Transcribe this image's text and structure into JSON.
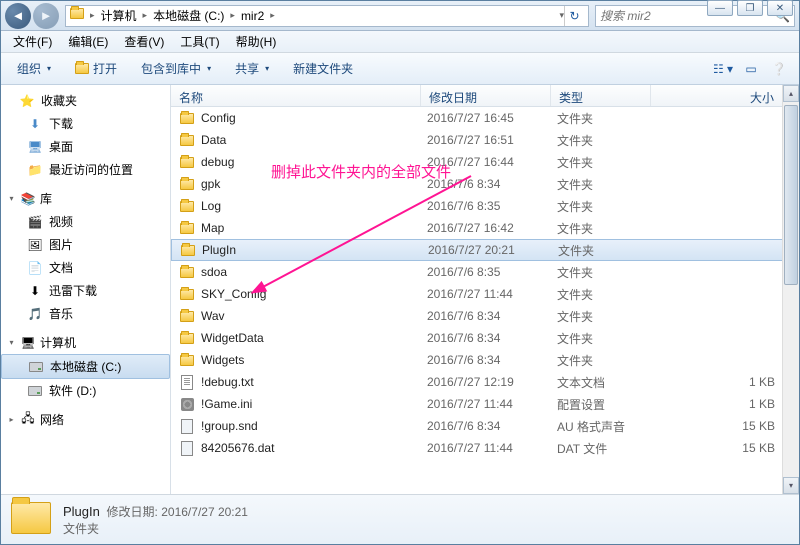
{
  "breadcrumb": {
    "root": "计算机",
    "disk": "本地磁盘 (C:)",
    "folder": "mir2"
  },
  "search": {
    "placeholder": "搜索 mir2"
  },
  "window_controls": {
    "min": "—",
    "max": "❐",
    "close": "✕"
  },
  "menu": {
    "file": "文件(F)",
    "edit": "编辑(E)",
    "view": "查看(V)",
    "tools": "工具(T)",
    "help": "帮助(H)"
  },
  "toolbar": {
    "organize": "组织",
    "open": "打开",
    "include": "包含到库中",
    "share": "共享",
    "newfolder": "新建文件夹"
  },
  "sidebar": {
    "fav_header": "收藏夹",
    "fav_items": [
      "下载",
      "桌面",
      "最近访问的位置"
    ],
    "lib_header": "库",
    "lib_items": [
      "视频",
      "图片",
      "文档",
      "迅雷下载",
      "音乐"
    ],
    "comp_header": "计算机",
    "comp_items": [
      "本地磁盘 (C:)",
      "软件 (D:)"
    ],
    "net_header": "网络"
  },
  "columns": {
    "name": "名称",
    "date": "修改日期",
    "type": "类型",
    "size": "大小"
  },
  "files": [
    {
      "name": "Config",
      "date": "2016/7/27 16:45",
      "type": "文件夹",
      "size": "",
      "icon": "folder"
    },
    {
      "name": "Data",
      "date": "2016/7/27 16:51",
      "type": "文件夹",
      "size": "",
      "icon": "folder"
    },
    {
      "name": "debug",
      "date": "2016/7/27 16:44",
      "type": "文件夹",
      "size": "",
      "icon": "folder"
    },
    {
      "name": "gpk",
      "date": "2016/7/6 8:34",
      "type": "文件夹",
      "size": "",
      "icon": "folder"
    },
    {
      "name": "Log",
      "date": "2016/7/6 8:35",
      "type": "文件夹",
      "size": "",
      "icon": "folder"
    },
    {
      "name": "Map",
      "date": "2016/7/27 16:42",
      "type": "文件夹",
      "size": "",
      "icon": "folder"
    },
    {
      "name": "PlugIn",
      "date": "2016/7/27 20:21",
      "type": "文件夹",
      "size": "",
      "icon": "folder",
      "selected": true
    },
    {
      "name": "sdoa",
      "date": "2016/7/6 8:35",
      "type": "文件夹",
      "size": "",
      "icon": "folder"
    },
    {
      "name": "SKY_Config",
      "date": "2016/7/27 11:44",
      "type": "文件夹",
      "size": "",
      "icon": "folder"
    },
    {
      "name": "Wav",
      "date": "2016/7/6 8:34",
      "type": "文件夹",
      "size": "",
      "icon": "folder"
    },
    {
      "name": "WidgetData",
      "date": "2016/7/6 8:34",
      "type": "文件夹",
      "size": "",
      "icon": "folder"
    },
    {
      "name": "Widgets",
      "date": "2016/7/6 8:34",
      "type": "文件夹",
      "size": "",
      "icon": "folder"
    },
    {
      "name": "!debug.txt",
      "date": "2016/7/27 12:19",
      "type": "文本文档",
      "size": "1 KB",
      "icon": "txt"
    },
    {
      "name": "!Game.ini",
      "date": "2016/7/27 11:44",
      "type": "配置设置",
      "size": "1 KB",
      "icon": "ini"
    },
    {
      "name": "!group.snd",
      "date": "2016/7/6 8:34",
      "type": "AU 格式声音",
      "size": "15 KB",
      "icon": "generic"
    },
    {
      "name": "84205676.dat",
      "date": "2016/7/27 11:44",
      "type": "DAT 文件",
      "size": "15 KB",
      "icon": "generic"
    }
  ],
  "status": {
    "name": "PlugIn",
    "date_label": "修改日期:",
    "date": "2016/7/27 20:21",
    "type": "文件夹"
  },
  "annotation": {
    "text": "删掉此文件夹内的全部文件"
  }
}
